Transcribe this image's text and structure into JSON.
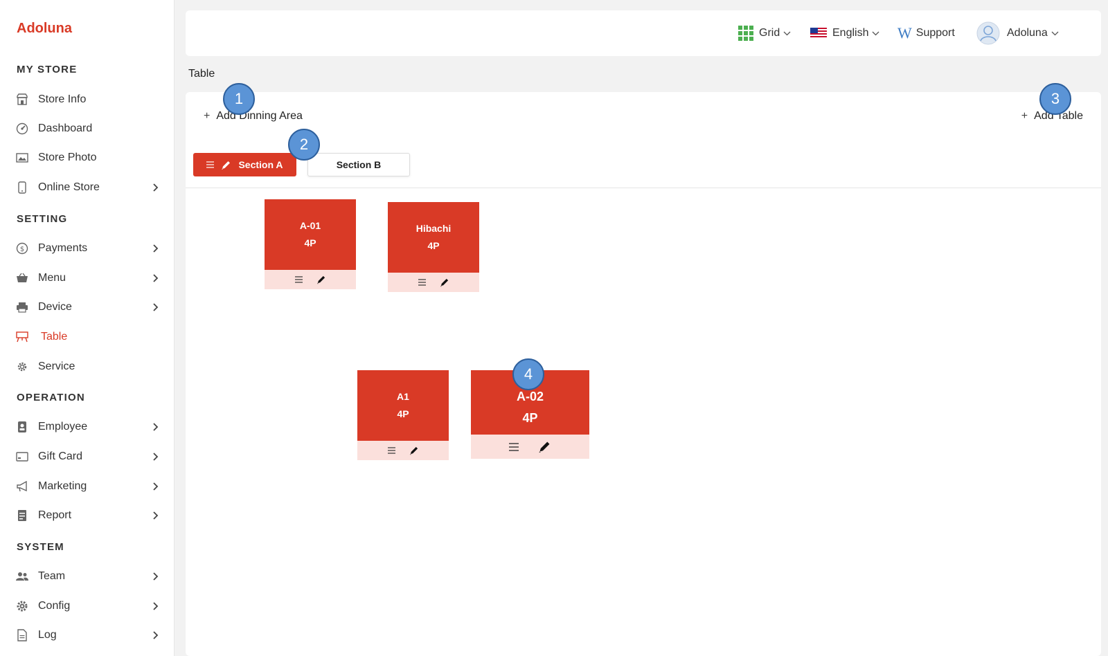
{
  "brand": "Adoluna",
  "colors": {
    "accent": "#d93a26",
    "badge": "#5b94d6",
    "table_footer": "#fbe0dc"
  },
  "sidebar": {
    "sections": [
      {
        "title": "MY STORE",
        "items": [
          {
            "label": "Store Info",
            "icon": "store-icon",
            "chevron": false
          },
          {
            "label": "Dashboard",
            "icon": "dashboard-icon",
            "chevron": false
          },
          {
            "label": "Store Photo",
            "icon": "photo-icon",
            "chevron": false
          },
          {
            "label": "Online Store",
            "icon": "mobile-icon",
            "chevron": true
          }
        ]
      },
      {
        "title": "SETTING",
        "items": [
          {
            "label": "Payments",
            "icon": "dollar-icon",
            "chevron": true
          },
          {
            "label": "Menu",
            "icon": "basket-icon",
            "chevron": true
          },
          {
            "label": "Device",
            "icon": "printer-icon",
            "chevron": true
          },
          {
            "label": "Table",
            "icon": "table-icon",
            "chevron": false,
            "active": true
          },
          {
            "label": "Service",
            "icon": "gear-icon",
            "chevron": false
          }
        ]
      },
      {
        "title": "OPERATION",
        "items": [
          {
            "label": "Employee",
            "icon": "badge-icon",
            "chevron": true
          },
          {
            "label": "Gift Card",
            "icon": "giftcard-icon",
            "chevron": true
          },
          {
            "label": "Marketing",
            "icon": "megaphone-icon",
            "chevron": true
          },
          {
            "label": "Report",
            "icon": "report-icon",
            "chevron": true
          }
        ]
      },
      {
        "title": "SYSTEM",
        "items": [
          {
            "label": "Team",
            "icon": "team-icon",
            "chevron": true
          },
          {
            "label": "Config",
            "icon": "cog-icon",
            "chevron": true
          },
          {
            "label": "Log",
            "icon": "document-icon",
            "chevron": true
          }
        ]
      }
    ]
  },
  "topbar": {
    "grid_label": "Grid",
    "language_label": "English",
    "support_label": "Support",
    "user_label": "Adoluna"
  },
  "page": {
    "title": "Table",
    "add_area_label": "Add Dinning Area",
    "add_table_label": "Add Table",
    "sections": [
      {
        "label": "Section A",
        "active": true
      },
      {
        "label": "Section B",
        "active": false
      }
    ],
    "tables": [
      {
        "name": "A-01",
        "seats": "4P"
      },
      {
        "name": "Hibachi",
        "seats": "4P"
      },
      {
        "name": "A1",
        "seats": "4P"
      },
      {
        "name": "A-02",
        "seats": "4P"
      }
    ]
  },
  "annotations": [
    "1",
    "2",
    "3",
    "4"
  ]
}
